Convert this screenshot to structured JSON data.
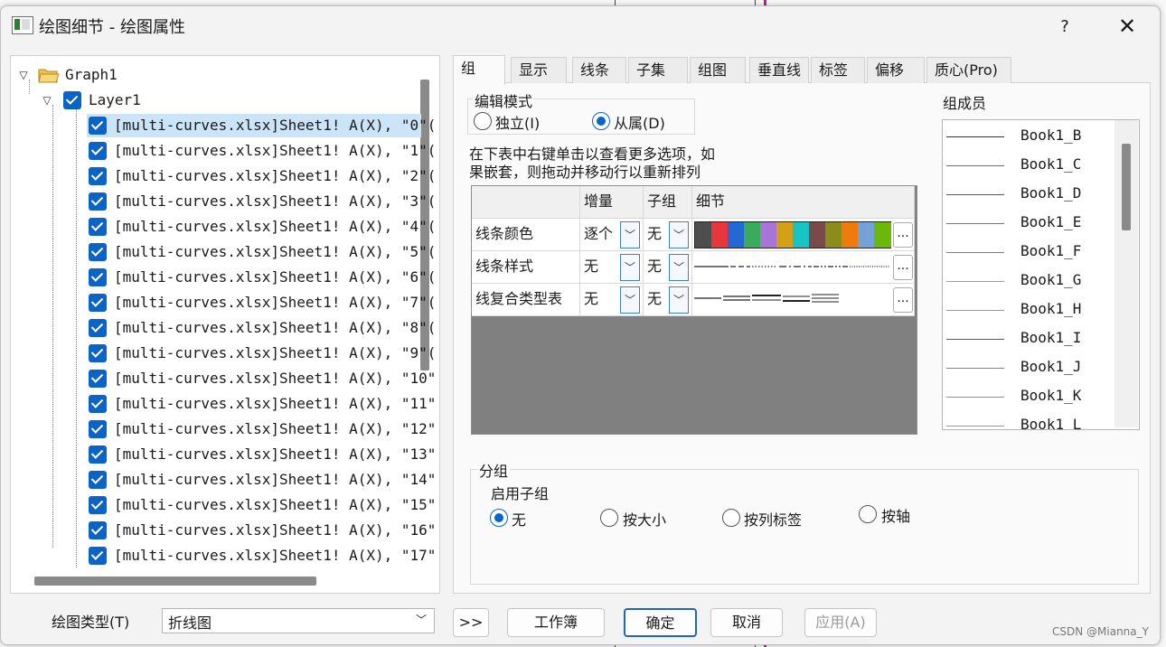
{
  "window": {
    "title": "绘图细节 - 绘图属性",
    "help_label": "?",
    "close_label": "✕"
  },
  "tree": {
    "root": "Graph1",
    "layer": "Layer1",
    "items": [
      "[multi-curves.xlsx]Sheet1! A(X), \"0\"(",
      "[multi-curves.xlsx]Sheet1! A(X), \"1\"(",
      "[multi-curves.xlsx]Sheet1! A(X), \"2\"(",
      "[multi-curves.xlsx]Sheet1! A(X), \"3\"(",
      "[multi-curves.xlsx]Sheet1! A(X), \"4\"(",
      "[multi-curves.xlsx]Sheet1! A(X), \"5\"(",
      "[multi-curves.xlsx]Sheet1! A(X), \"6\"(",
      "[multi-curves.xlsx]Sheet1! A(X), \"7\"(",
      "[multi-curves.xlsx]Sheet1! A(X), \"8\"(",
      "[multi-curves.xlsx]Sheet1! A(X), \"9\"(",
      "[multi-curves.xlsx]Sheet1! A(X), \"10\"",
      "[multi-curves.xlsx]Sheet1! A(X), \"11\"",
      "[multi-curves.xlsx]Sheet1! A(X), \"12\"",
      "[multi-curves.xlsx]Sheet1! A(X), \"13\"",
      "[multi-curves.xlsx]Sheet1! A(X), \"14\"",
      "[multi-curves.xlsx]Sheet1! A(X), \"15\"",
      "[multi-curves.xlsx]Sheet1! A(X), \"16\"",
      "[multi-curves.xlsx]Sheet1! A(X), \"17\""
    ]
  },
  "tabs": [
    "组",
    "显示",
    "线条",
    "子集",
    "组图",
    "垂直线",
    "标签",
    "偏移",
    "质心(Pro)"
  ],
  "edit_mode": {
    "title": "编辑模式",
    "option_independent": "独立(I)",
    "option_dependent": "从属(D)"
  },
  "hint_line1": "在下表中右键单击以查看更多选项，如",
  "hint_line2": "果嵌套，则拖动并移动行以重新排列",
  "grid": {
    "headers": [
      "增量",
      "子组",
      "细节"
    ],
    "rows": [
      {
        "name": "线条颜色",
        "increment": "逐个",
        "subgroup": "无"
      },
      {
        "name": "线条样式",
        "increment": "无",
        "subgroup": "无"
      },
      {
        "name": "线复合类型表",
        "increment": "无",
        "subgroup": "无"
      }
    ],
    "ellipsis": "...",
    "color_swatches": [
      "#4d4d4d",
      "#e8363a",
      "#2468d6",
      "#3aab5c",
      "#a874d6",
      "#d4a017",
      "#19c4c4",
      "#7a4a4a",
      "#8c8c1a",
      "#f07a0a",
      "#74a2d8",
      "#6ab80a"
    ]
  },
  "members": {
    "title": "组成员",
    "items": [
      {
        "label": "Book1_B",
        "color": "#333333"
      },
      {
        "label": "Book1_C",
        "color": "#d04040"
      },
      {
        "label": "Book1_D",
        "color": "#2a5db0"
      },
      {
        "label": "Book1_E",
        "color": "#2a9a6a"
      },
      {
        "label": "Book1_F",
        "color": "#9a5ac8"
      },
      {
        "label": "Book1_G",
        "color": "#c8a020"
      },
      {
        "label": "Book1_H",
        "color": "#30c0c8"
      },
      {
        "label": "Book1_I",
        "color": "#7a4a4a"
      },
      {
        "label": "Book1_J",
        "color": "#9a8a10"
      },
      {
        "label": "Book1_K",
        "color": "#e08010"
      },
      {
        "label": "Book1_L",
        "color": "#6aa0d8"
      }
    ]
  },
  "grouping": {
    "title": "分组",
    "enable_label": "启用子组",
    "options": [
      "无",
      "按大小",
      "按列标签",
      "按轴"
    ]
  },
  "bottom": {
    "plot_type_label": "绘图类型(T)",
    "plot_type_value": "折线图",
    "expand_label": ">>",
    "workbook_label": "工作簿",
    "ok_label": "确定",
    "cancel_label": "取消",
    "apply_label": "应用(A)"
  },
  "watermark": "CSDN @Mianna_Y"
}
